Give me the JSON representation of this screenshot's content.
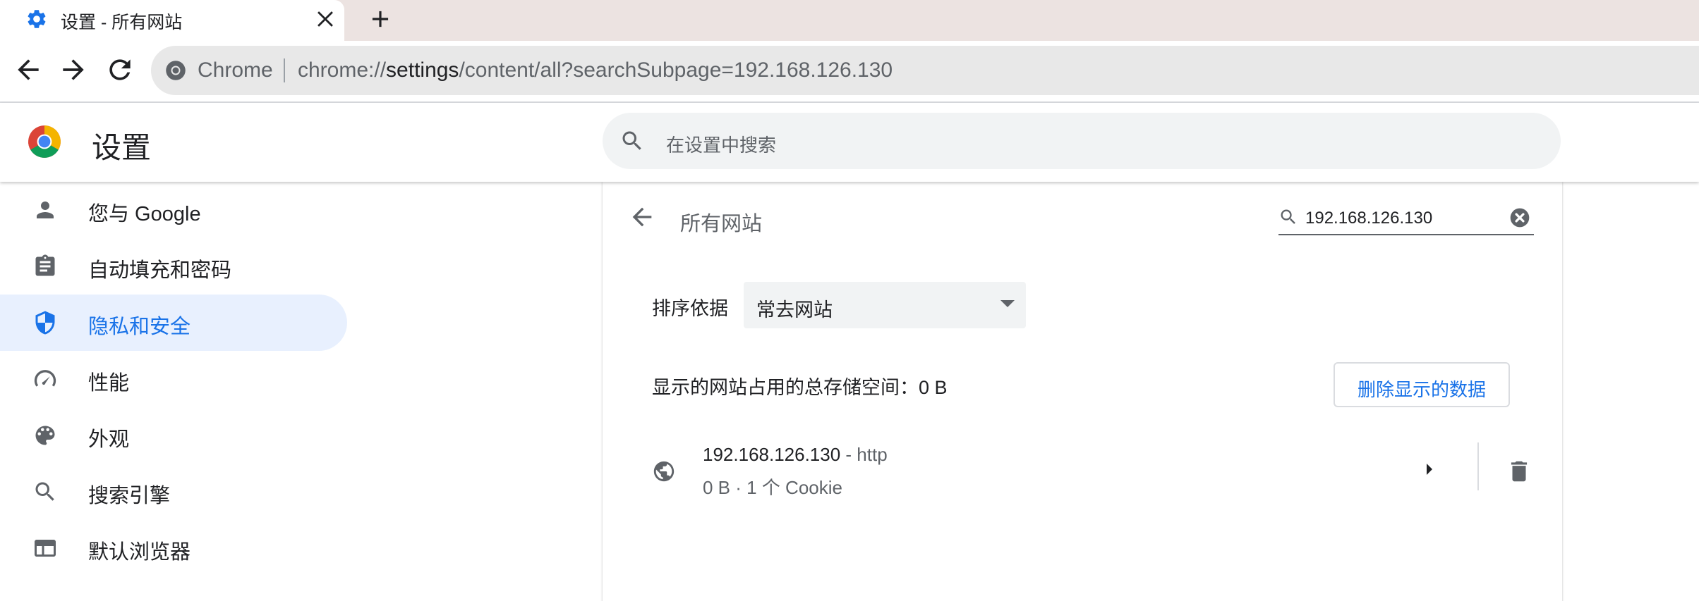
{
  "tab": {
    "title": "设置 - 所有网站",
    "icon": "gear-icon"
  },
  "toolbar": {
    "site_label": "Chrome",
    "url_scheme": "chrome://",
    "url_host": "settings",
    "url_path": "/content/all?searchSubpage=192.168.126.130"
  },
  "header": {
    "title": "设置",
    "search_placeholder": "在设置中搜索"
  },
  "sidebar": {
    "items": [
      {
        "label": "您与 Google",
        "icon": "person-icon",
        "active": false
      },
      {
        "label": "自动填充和密码",
        "icon": "clipboard-icon",
        "active": false
      },
      {
        "label": "隐私和安全",
        "icon": "shield-icon",
        "active": true
      },
      {
        "label": "性能",
        "icon": "speedometer-icon",
        "active": false
      },
      {
        "label": "外观",
        "icon": "palette-icon",
        "active": false
      },
      {
        "label": "搜索引擎",
        "icon": "search-icon",
        "active": false
      },
      {
        "label": "默认浏览器",
        "icon": "browser-window-icon",
        "active": false
      }
    ]
  },
  "main": {
    "title": "所有网站",
    "filter_value": "192.168.126.130",
    "sort_label": "排序依据",
    "sort_value": "常去网站",
    "storage_text": "显示的网站占用的总存储空间：0 B",
    "delete_button": "删除显示的数据",
    "sites": [
      {
        "host": "192.168.126.130",
        "protocol": " - http",
        "meta": "0 B · 1 个 Cookie"
      }
    ]
  },
  "colors": {
    "accent": "#1a73e8",
    "active_bg": "#e8f0fe",
    "tabstrip_bg": "#ece3e1"
  }
}
